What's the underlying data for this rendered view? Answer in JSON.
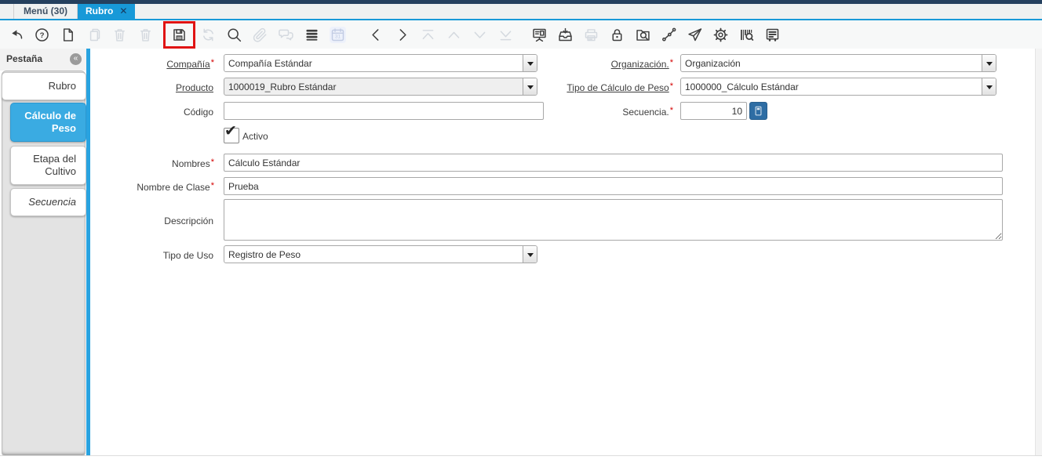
{
  "window": {
    "tabs": [
      {
        "label": "Menú (30)",
        "active": false
      },
      {
        "label": "Rubro",
        "active": true,
        "closable": true
      }
    ]
  },
  "icons": {
    "close": "✕",
    "collapse": "«",
    "check": "✔"
  },
  "toolbar": {
    "items": [
      {
        "name": "undo",
        "enabled": true
      },
      {
        "name": "help",
        "enabled": true
      },
      {
        "name": "new-record",
        "enabled": true
      },
      {
        "name": "copy-record",
        "enabled": false
      },
      {
        "name": "delete-record",
        "enabled": false
      },
      {
        "name": "delete-selection",
        "enabled": false
      },
      {
        "name": "save",
        "enabled": true,
        "highlighted": true
      },
      {
        "name": "refresh",
        "enabled": false
      },
      {
        "name": "find",
        "enabled": true
      },
      {
        "name": "attachment",
        "enabled": false
      },
      {
        "name": "chat",
        "enabled": false
      },
      {
        "name": "grid-toggle",
        "enabled": true
      },
      {
        "name": "calendar",
        "enabled": false
      },
      {
        "name": "previous-record",
        "enabled": true
      },
      {
        "name": "next-record",
        "enabled": true
      },
      {
        "name": "parent-record",
        "enabled": false
      },
      {
        "name": "up",
        "enabled": false
      },
      {
        "name": "down",
        "enabled": false
      },
      {
        "name": "detail-record",
        "enabled": false
      },
      {
        "name": "report",
        "enabled": true
      },
      {
        "name": "archive",
        "enabled": true
      },
      {
        "name": "print",
        "enabled": false
      },
      {
        "name": "lock",
        "enabled": true
      },
      {
        "name": "zoom-across",
        "enabled": true
      },
      {
        "name": "workflow",
        "enabled": true
      },
      {
        "name": "send",
        "enabled": true
      },
      {
        "name": "preferences",
        "enabled": true
      },
      {
        "name": "product-info",
        "enabled": true
      },
      {
        "name": "postit",
        "enabled": true
      }
    ]
  },
  "sidebar": {
    "title": "Pestaña",
    "tabs": [
      {
        "label": "Rubro",
        "level": 0,
        "active": false,
        "italic": false
      },
      {
        "label": "Cálculo de Peso",
        "level": 1,
        "active": true,
        "italic": false
      },
      {
        "label": "Etapa del Cultivo",
        "level": 1,
        "active": false,
        "italic": false
      },
      {
        "label": "Secuencia",
        "level": 1,
        "active": false,
        "italic": true
      }
    ]
  },
  "form": {
    "compania": {
      "label": "Compañía",
      "req": "*",
      "value": "Compañía Estándar"
    },
    "organizacion": {
      "label": "Organización.",
      "req": "*",
      "value": "Organización"
    },
    "producto": {
      "label": "Producto",
      "value": "1000019_Rubro Estándar"
    },
    "tipo_calculo_peso": {
      "label": "Tipo de Cálculo de Peso",
      "req": "*",
      "value": "1000000_Cálculo Estándar"
    },
    "codigo": {
      "label": "Código",
      "value": ""
    },
    "secuencia": {
      "label": "Secuencia.",
      "req": "*",
      "value": "10"
    },
    "activo": {
      "label": "Activo",
      "checked": true
    },
    "nombres": {
      "label": "Nombres",
      "req": "*",
      "value": "Cálculo Estándar"
    },
    "nombre_clase": {
      "label": "Nombre de Clase",
      "req": "*",
      "value": "Prueba"
    },
    "descripcion": {
      "label": "Descripción",
      "value": ""
    },
    "tipo_uso": {
      "label": "Tipo de Uso",
      "value": "Registro de Peso"
    }
  },
  "colors": {
    "accent_blue": "#1899d8",
    "sidebar_active_blue": "#3aabe2",
    "vertical_line_blue": "#29a3e0",
    "highlight_red": "#e01313",
    "calc_button_blue": "#2e6da4",
    "required_red": "#d40000"
  }
}
